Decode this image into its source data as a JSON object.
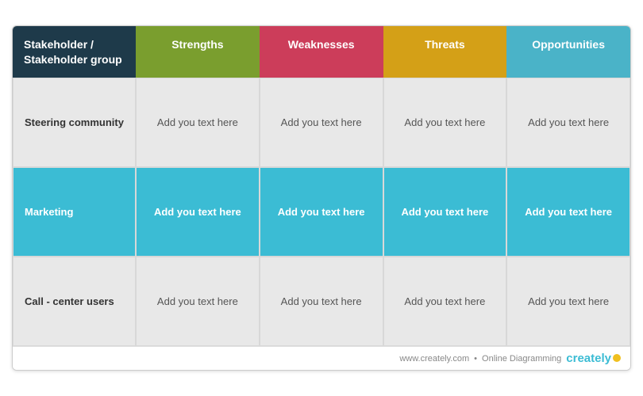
{
  "header": {
    "stakeholder_label": "Stakeholder / Stakeholder group",
    "strengths_label": "Strengths",
    "weaknesses_label": "Weaknesses",
    "threats_label": "Threats",
    "opportunities_label": "Opportunities"
  },
  "rows": [
    {
      "id": "row-steering",
      "label": "Steering community",
      "highlight": false,
      "cells": [
        "Add you text here",
        "Add you text here",
        "Add you text here",
        "Add you text here"
      ]
    },
    {
      "id": "row-marketing",
      "label": "Marketing",
      "highlight": true,
      "cells": [
        "Add you text here",
        "Add you text here",
        "Add you text here",
        "Add you text here"
      ]
    },
    {
      "id": "row-callcenter",
      "label": "Call - center users",
      "highlight": false,
      "cells": [
        "Add you text here",
        "Add you text here",
        "Add you text here",
        "Add you text here"
      ]
    }
  ],
  "footer": {
    "url": "www.creately.com",
    "separator": "•",
    "tagline": "Online Diagramming",
    "brand": "creately"
  }
}
